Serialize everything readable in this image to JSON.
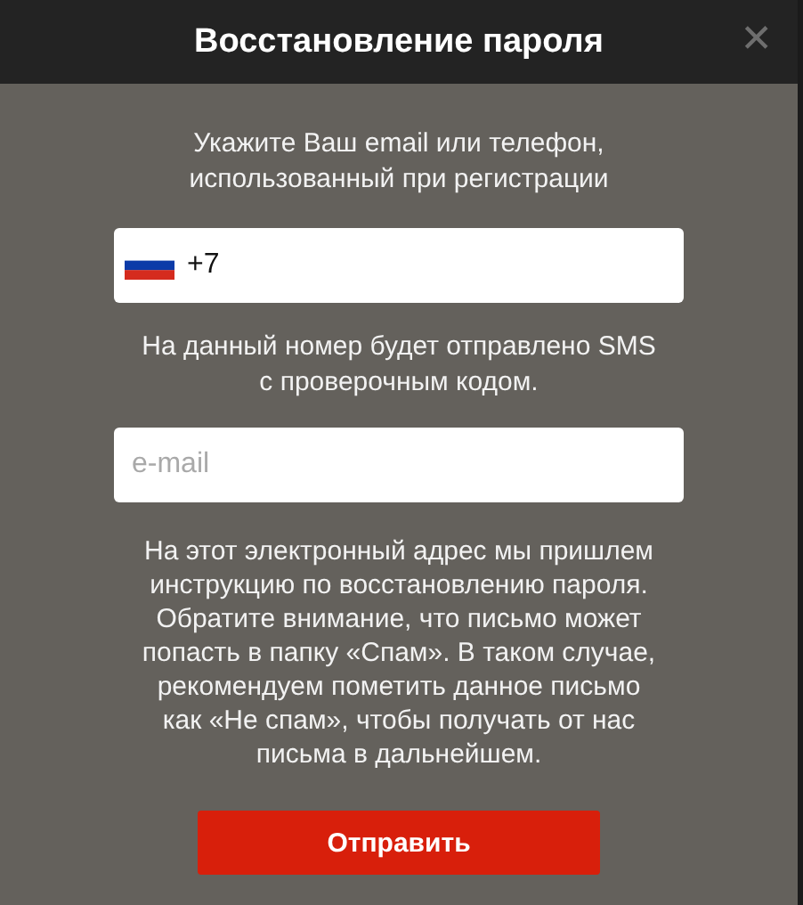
{
  "dialog": {
    "title": "Восстановление пароля",
    "close": "✕"
  },
  "intro": "Укажите Ваш email или телефон,\nиспользованный при регистрации",
  "phone_field": {
    "value": "+7"
  },
  "phone_note": "На данный номер будет отправлено SMS\nс проверочным кодом.",
  "email_field": {
    "placeholder": "e-mail"
  },
  "email_note": "На этот электронный адрес мы пришлем\nинструкцию по восстановлению пароля.\nОбратите внимание, что письмо может\nпопасть в папку «Спам». В таком случае,\nрекомендуем пометить данное письмо\nкак «Не спам», чтобы получать от нас\nписьма в дальнейшем.",
  "submit_button": "Отправить"
}
